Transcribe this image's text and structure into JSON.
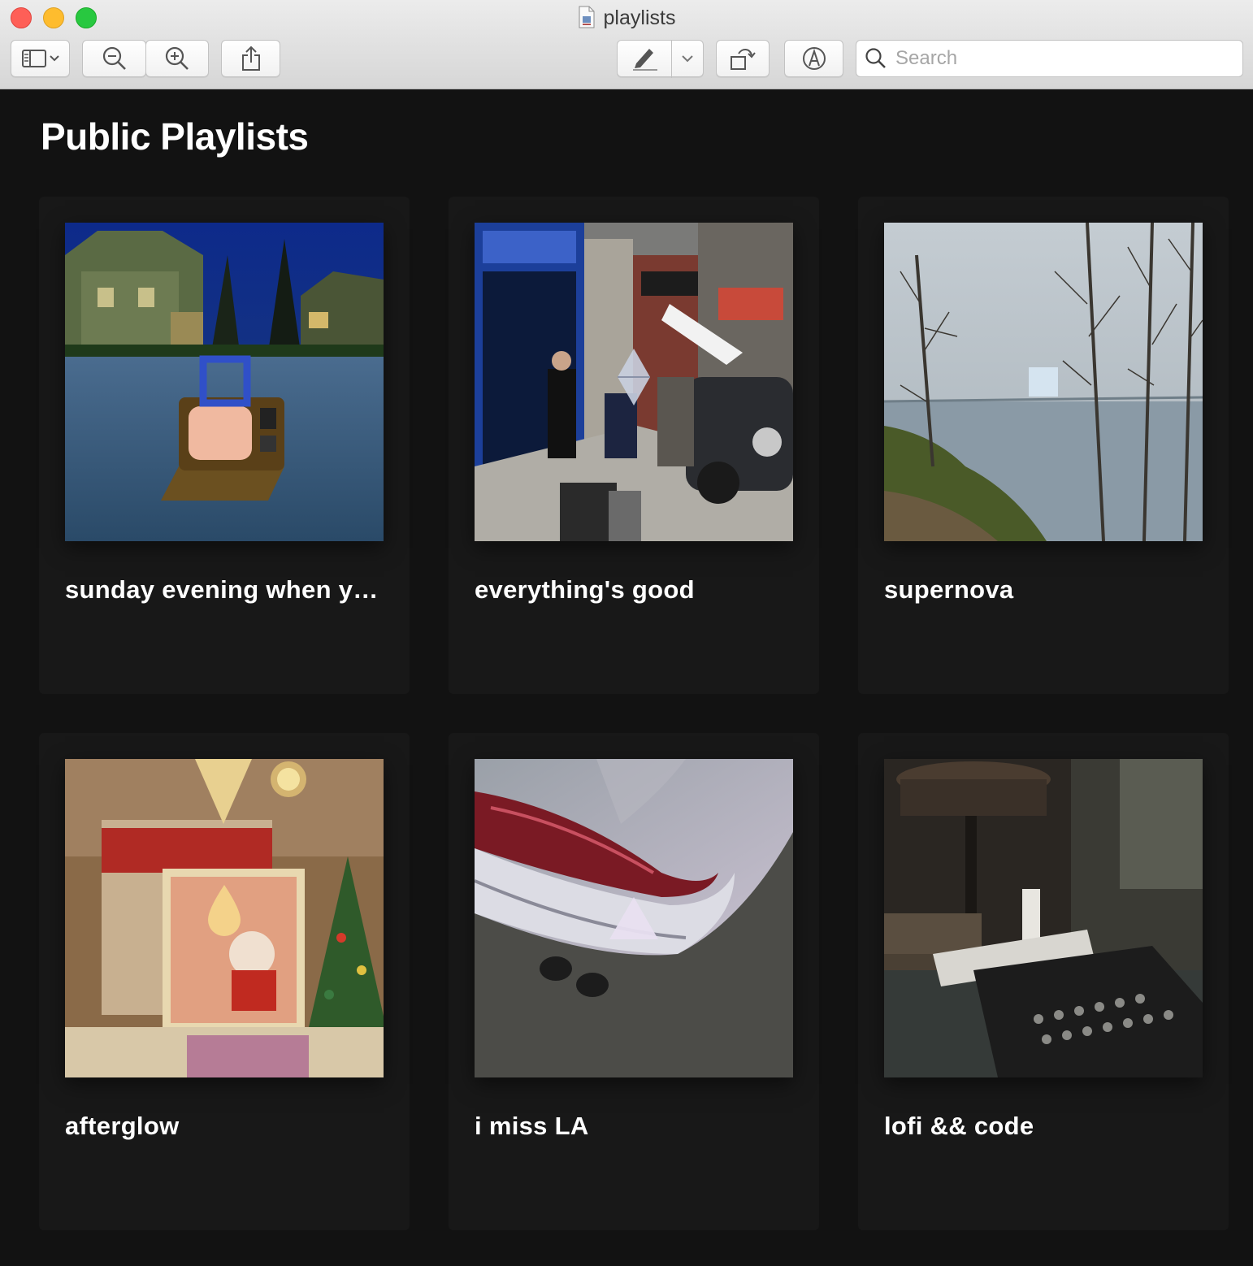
{
  "window": {
    "title": "playlists",
    "search_placeholder": "Search"
  },
  "toolbar": {
    "icons": [
      "sidebar-toggle-icon",
      "zoom-out-icon",
      "zoom-in-icon",
      "share-icon",
      "markup-pen-icon",
      "chevron-down-icon",
      "rotate-icon",
      "annotate-icon",
      "search-icon"
    ]
  },
  "main": {
    "heading": "Public Playlists",
    "playlists": [
      {
        "title": "sunday evening when yo...",
        "cover": "tv-on-street-at-dusk"
      },
      {
        "title": "everything's good",
        "cover": "vintage-street-scene"
      },
      {
        "title": "supernova",
        "cover": "lake-behind-bare-trees"
      },
      {
        "title": "afterglow",
        "cover": "christmas-decorations"
      },
      {
        "title": "i miss LA",
        "cover": "classic-car-taillight"
      },
      {
        "title": "lofi && code",
        "cover": "typewriter-on-desk"
      }
    ]
  },
  "colors": {
    "background": "#121212",
    "card": "#181818",
    "text": "#ffffff"
  }
}
